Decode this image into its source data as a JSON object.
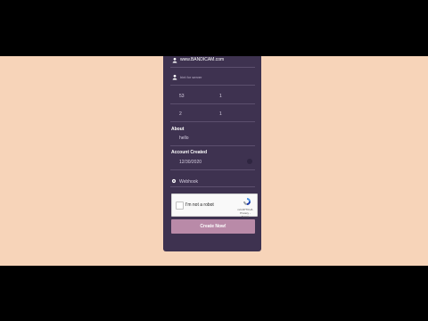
{
  "form": {
    "username": "www.BANDICAM.com",
    "server_placeholder": "hint for server",
    "row1": {
      "left": "53",
      "right": "1"
    },
    "row2": {
      "left": "2",
      "right": "1"
    },
    "about_label": "About",
    "about_value": "hello",
    "account_created_label": "Account Created",
    "account_created_value": "12/30/2020",
    "webhook_label": "Webhook",
    "captcha_label": "I'm not a robot",
    "captcha_brand": "reCAPTCHA",
    "captcha_terms": "Privacy - Terms",
    "create_button": "Create Now!"
  },
  "colors": {
    "page_bg": "#f7d4b9",
    "panel_bg": "#3e3250",
    "button_bg": "#b98aa8"
  }
}
